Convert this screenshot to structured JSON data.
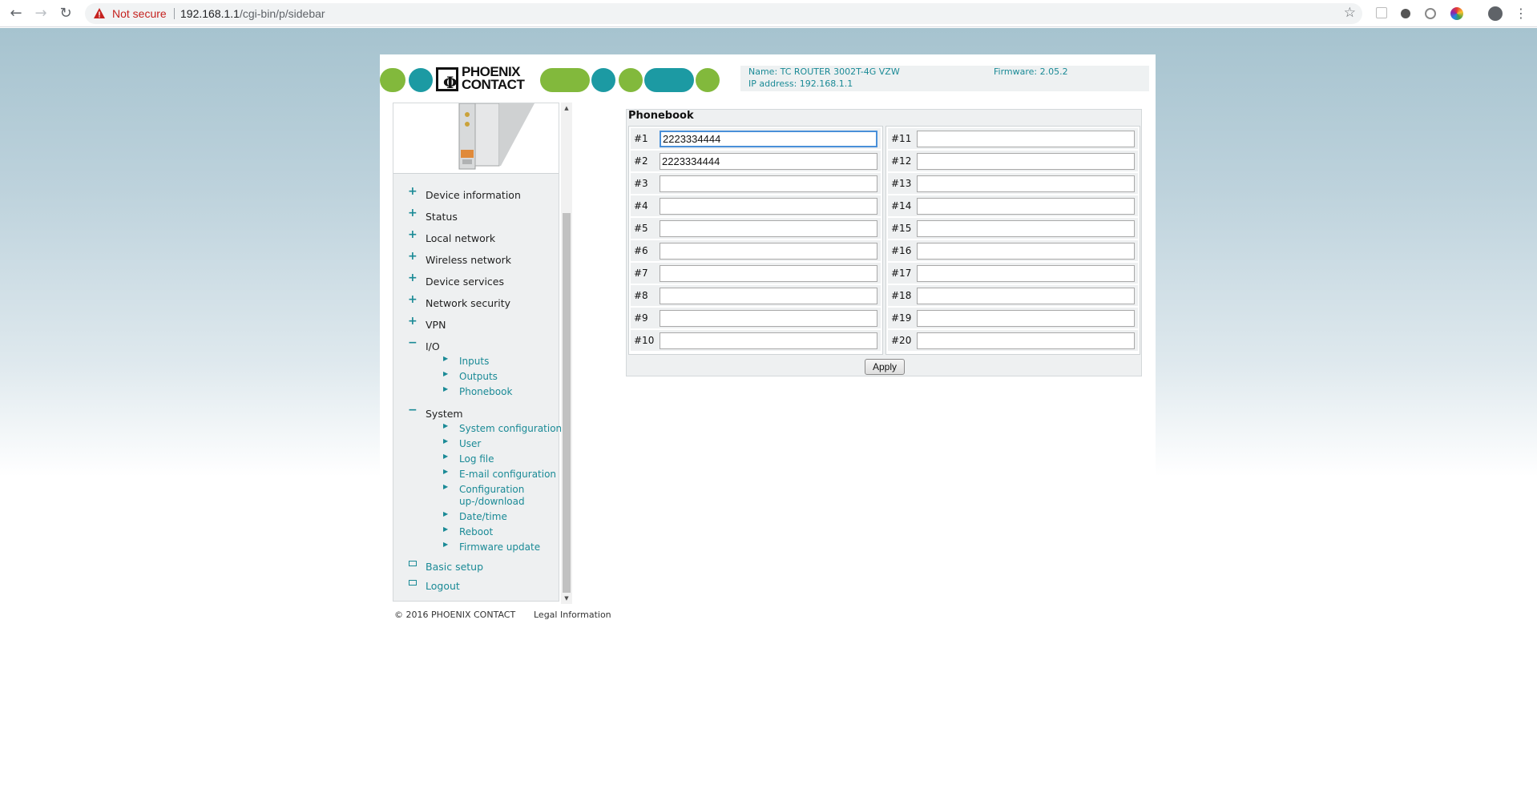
{
  "browser": {
    "security_label": "Not secure",
    "url_host": "192.168.1.1",
    "url_path": "/cgi-bin/p/sidebar"
  },
  "header": {
    "brand_line1": "PHOENIX",
    "brand_line2": "CONTACT",
    "name_label": "Name: TC ROUTER 3002T-4G VZW",
    "ip_label": "IP address: 192.168.1.1",
    "firmware_label": "Firmware: 2.05.2"
  },
  "sidebar": {
    "items": [
      {
        "label": "Device information",
        "expanded": false
      },
      {
        "label": "Status",
        "expanded": false
      },
      {
        "label": "Local network",
        "expanded": false
      },
      {
        "label": "Wireless network",
        "expanded": false
      },
      {
        "label": "Device services",
        "expanded": false
      },
      {
        "label": "Network security",
        "expanded": false
      },
      {
        "label": "VPN",
        "expanded": false
      },
      {
        "label": "I/O",
        "expanded": true
      },
      {
        "label": "System",
        "expanded": true
      }
    ],
    "io_sub": [
      "Inputs",
      "Outputs",
      "Phonebook"
    ],
    "system_sub": [
      "System configuration",
      "User",
      "Log file",
      "E-mail configuration",
      "Configuration up-/download",
      "Date/time",
      "Reboot",
      "Firmware update"
    ],
    "basic_setup": "Basic setup",
    "logout": "Logout"
  },
  "footer": {
    "copyright": "© 2016 PHOENIX CONTACT",
    "legal": "Legal Information"
  },
  "phonebook": {
    "title": "Phonebook",
    "entries": [
      {
        "num": "#1",
        "value": "2223334444"
      },
      {
        "num": "#2",
        "value": "2223334444"
      },
      {
        "num": "#3",
        "value": ""
      },
      {
        "num": "#4",
        "value": ""
      },
      {
        "num": "#5",
        "value": ""
      },
      {
        "num": "#6",
        "value": ""
      },
      {
        "num": "#7",
        "value": ""
      },
      {
        "num": "#8",
        "value": ""
      },
      {
        "num": "#9",
        "value": ""
      },
      {
        "num": "#10",
        "value": ""
      },
      {
        "num": "#11",
        "value": ""
      },
      {
        "num": "#12",
        "value": ""
      },
      {
        "num": "#13",
        "value": ""
      },
      {
        "num": "#14",
        "value": ""
      },
      {
        "num": "#15",
        "value": ""
      },
      {
        "num": "#16",
        "value": ""
      },
      {
        "num": "#17",
        "value": ""
      },
      {
        "num": "#18",
        "value": ""
      },
      {
        "num": "#19",
        "value": ""
      },
      {
        "num": "#20",
        "value": ""
      }
    ],
    "apply_label": "Apply"
  },
  "colors": {
    "accent_teal": "#1a8a96",
    "brand_green": "#82b93c",
    "brand_teal": "#1c9aa3"
  }
}
